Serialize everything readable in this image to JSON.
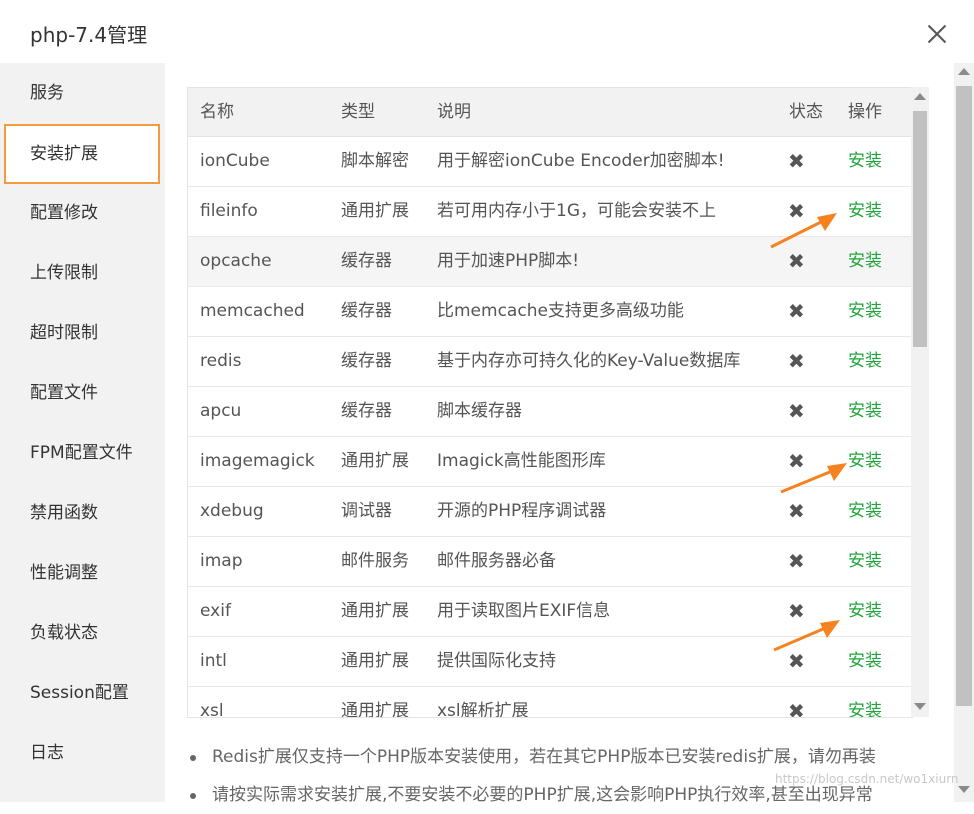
{
  "title": "php-7.4管理",
  "sidebar": {
    "items": [
      {
        "label": "服务"
      },
      {
        "label": "安装扩展"
      },
      {
        "label": "配置修改"
      },
      {
        "label": "上传限制"
      },
      {
        "label": "超时限制"
      },
      {
        "label": "配置文件"
      },
      {
        "label": "FPM配置文件"
      },
      {
        "label": "禁用函数"
      },
      {
        "label": "性能调整"
      },
      {
        "label": "负载状态"
      },
      {
        "label": "Session配置"
      },
      {
        "label": "日志"
      }
    ],
    "active_index": 1
  },
  "table": {
    "headers": {
      "name": "名称",
      "type": "类型",
      "desc": "说明",
      "status": "状态",
      "op": "操作"
    },
    "rows": [
      {
        "name": "ionCube",
        "type": "脚本解密",
        "desc": "用于解密ionCube Encoder加密脚本!",
        "status": "✖",
        "op": "安装"
      },
      {
        "name": "fileinfo",
        "type": "通用扩展",
        "desc": "若可用内存小于1G，可能会安装不上",
        "status": "✖",
        "op": "安装"
      },
      {
        "name": "opcache",
        "type": "缓存器",
        "desc": "用于加速PHP脚本!",
        "status": "✖",
        "op": "安装"
      },
      {
        "name": "memcached",
        "type": "缓存器",
        "desc": "比memcache支持更多高级功能",
        "status": "✖",
        "op": "安装"
      },
      {
        "name": "redis",
        "type": "缓存器",
        "desc": "基于内存亦可持久化的Key-Value数据库",
        "status": "✖",
        "op": "安装"
      },
      {
        "name": "apcu",
        "type": "缓存器",
        "desc": "脚本缓存器",
        "status": "✖",
        "op": "安装"
      },
      {
        "name": "imagemagick",
        "type": "通用扩展",
        "desc": "Imagick高性能图形库",
        "status": "✖",
        "op": "安装"
      },
      {
        "name": "xdebug",
        "type": "调试器",
        "desc": "开源的PHP程序调试器",
        "status": "✖",
        "op": "安装"
      },
      {
        "name": "imap",
        "type": "邮件服务",
        "desc": "邮件服务器必备",
        "status": "✖",
        "op": "安装"
      },
      {
        "name": "exif",
        "type": "通用扩展",
        "desc": "用于读取图片EXIF信息",
        "status": "✖",
        "op": "安装"
      },
      {
        "name": "intl",
        "type": "通用扩展",
        "desc": "提供国际化支持",
        "status": "✖",
        "op": "安装"
      },
      {
        "name": "xsl",
        "type": "通用扩展",
        "desc": "xsl解析扩展",
        "status": "✖",
        "op": "安装"
      }
    ]
  },
  "notes": [
    "Redis扩展仅支持一个PHP版本安装使用，若在其它PHP版本已安装redis扩展，请勿再装",
    "请按实际需求安装扩展,不要安装不必要的PHP扩展,这会影响PHP执行效率,甚至出现异常"
  ],
  "watermark": "https://blog.csdn.net/wo1xiurn",
  "colors": {
    "accent_green": "#20a53a",
    "active_border": "#f39b3d",
    "arrow": "#f5821f"
  }
}
